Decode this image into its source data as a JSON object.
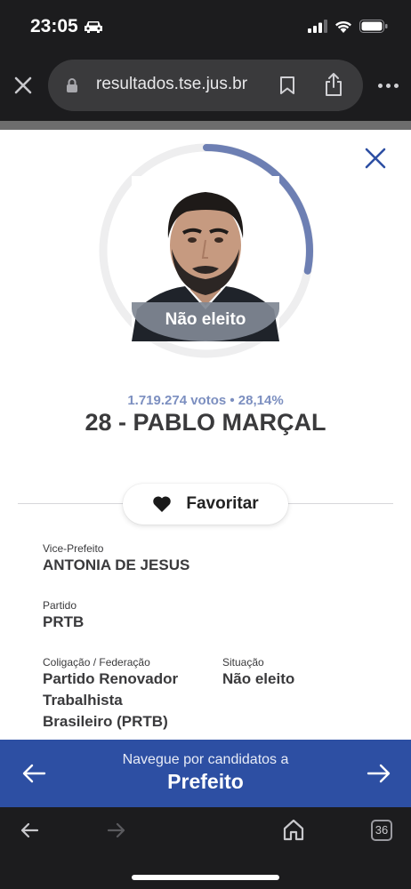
{
  "status_bar": {
    "time": "23:05"
  },
  "browser": {
    "url": "resultados.tse.jus.br",
    "tabs_count": "36"
  },
  "candidate": {
    "result_badge": "Não eleito",
    "votes": "1.719.274 votos • 28,14%",
    "vote_share_fraction": 0.2814,
    "name": "28 - PABLO MARÇAL",
    "favorite_label": "Favoritar"
  },
  "details": {
    "vice_label": "Vice-Prefeito",
    "vice_value": "ANTONIA DE JESUS",
    "party_label": "Partido",
    "party_value": "PRTB",
    "coalition_label": "Coligação / Federação",
    "coalition_lines": [
      "Partido Renovador",
      "Trabalhista",
      "Brasileiro (PRTB)"
    ],
    "situation_label": "Situação",
    "situation_value": "Não eleito"
  },
  "navigation": {
    "subtitle": "Navegue por candidatos a",
    "title": "Prefeito"
  },
  "colors": {
    "accent_blue": "#2d4fa3",
    "progress_arc": "#6d7fb3",
    "votes_text": "#7c8fc0"
  },
  "icons": [
    "car-icon",
    "signal-icon",
    "wifi-icon",
    "battery-icon",
    "close-icon",
    "lock-icon",
    "bookmark-icon",
    "share-icon",
    "more-icon",
    "heart-icon",
    "arrow-left-icon",
    "arrow-right-icon",
    "home-icon",
    "tabs-icon"
  ]
}
